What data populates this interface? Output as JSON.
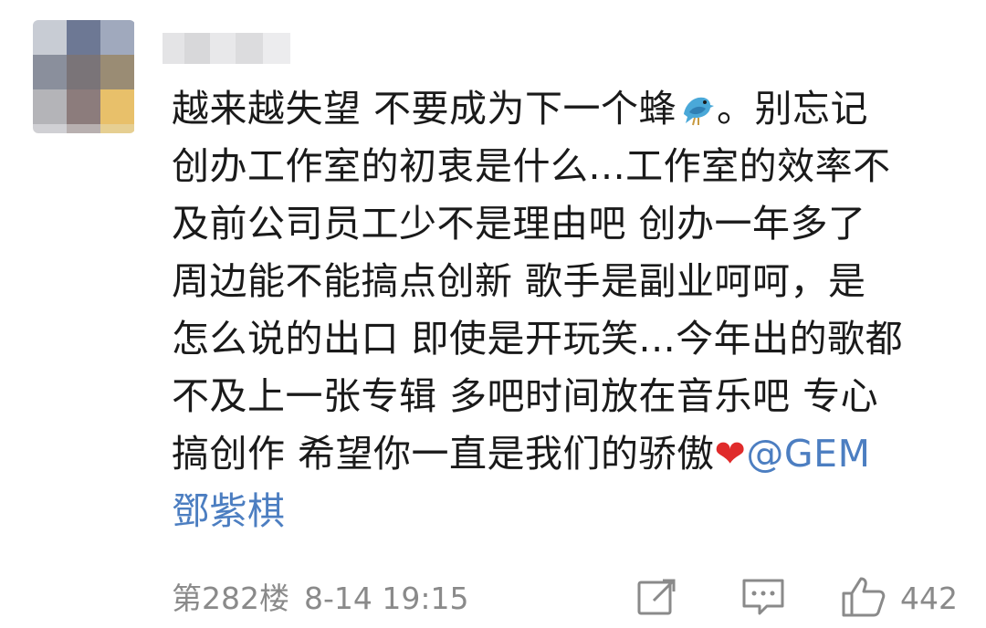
{
  "comment": {
    "avatar_icon": "avatar-pixelated",
    "username": "",
    "content_lines": [
      [
        "越来越失望 不要成为下一个蜂",
        "。别忘记"
      ],
      [
        "创办工作室的初衷是什么...工作室的效率不"
      ],
      [
        "及前公司员工少不是理由吧 创办一年多了"
      ],
      [
        "周边能不能搞点创新 歌手是副业呵呵，是"
      ],
      [
        "怎么说的出口 即使是开玩笑...今年出的歌都"
      ],
      [
        "不及上一张专辑  多吧时间放在音乐吧 专心"
      ],
      [
        "搞创作   希望你一直是我们的骄傲",
        "❤",
        "@GEM"
      ],
      [
        "鄧紫棋"
      ]
    ],
    "emoji_bird": "bird-emoji",
    "floor": "第282楼",
    "time": "8-14 19:15",
    "likes": "442",
    "colors": {
      "text": "#1a1a1a",
      "mention": "#4c7ec1",
      "meta": "#8a8a8a",
      "heart": "#e02b2b"
    }
  }
}
